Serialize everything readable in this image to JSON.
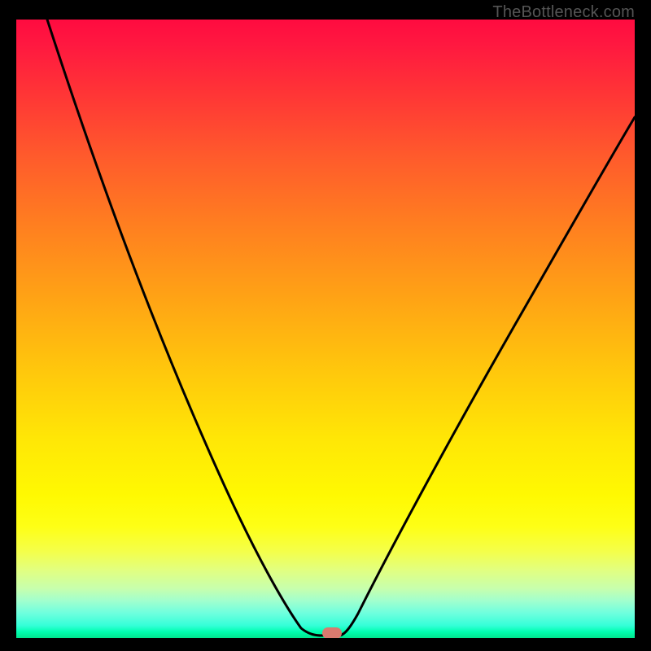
{
  "watermark": "TheBottleneck.com",
  "chart_data": {
    "type": "line",
    "title": "",
    "xlabel": "",
    "ylabel": "",
    "xlim": [
      0,
      100
    ],
    "ylim": [
      0,
      100
    ],
    "grid": false,
    "series": [
      {
        "name": "curve",
        "x": [
          5,
          10,
          15,
          20,
          25,
          30,
          35,
          40,
          43,
          45,
          46,
          47,
          48,
          49,
          50,
          51,
          52,
          55,
          60,
          65,
          70,
          75,
          80,
          85,
          90,
          95,
          100
        ],
        "y": [
          100,
          89,
          78,
          68,
          58,
          49,
          40,
          30,
          22,
          16,
          12,
          8,
          4,
          1,
          0,
          0,
          0,
          7,
          18,
          28,
          37,
          46,
          54,
          61,
          67,
          72,
          76
        ]
      }
    ],
    "marker": {
      "x": 51,
      "y": 0.5
    },
    "background": "red-yellow-green vertical gradient"
  }
}
